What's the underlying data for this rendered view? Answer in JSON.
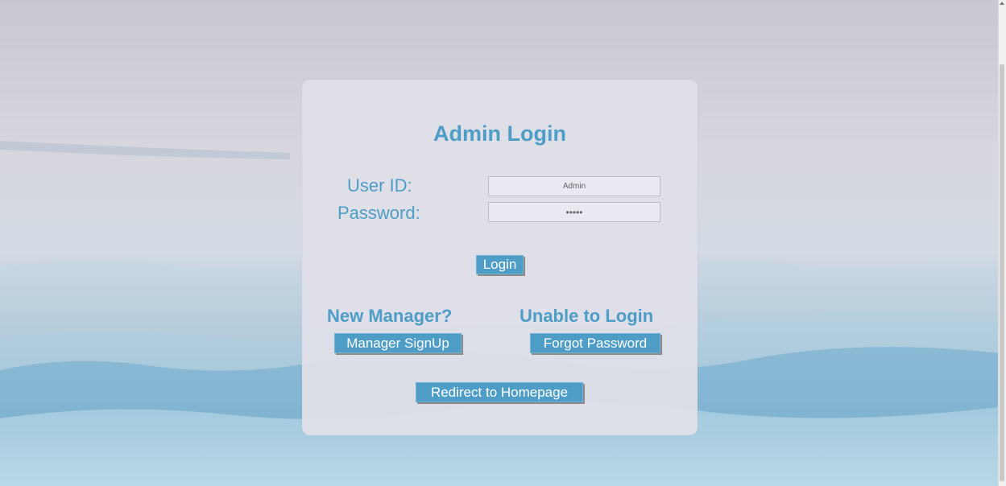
{
  "page": {
    "title": "Admin Login"
  },
  "form": {
    "user_label": "User ID:",
    "user_value": "Admin",
    "password_label": "Password:",
    "password_value": "•••••",
    "login_label": "Login"
  },
  "new_manager": {
    "heading": "New Manager?",
    "button_label": "Manager SignUp"
  },
  "unable_login": {
    "heading": "Unable to Login",
    "button_label": "Forgot Password"
  },
  "redirect": {
    "button_label": "Redirect to Homepage"
  },
  "colors": {
    "accent": "#4e9dc6",
    "card": "#dfdfe8",
    "field_bg": "#e9e9f1"
  }
}
